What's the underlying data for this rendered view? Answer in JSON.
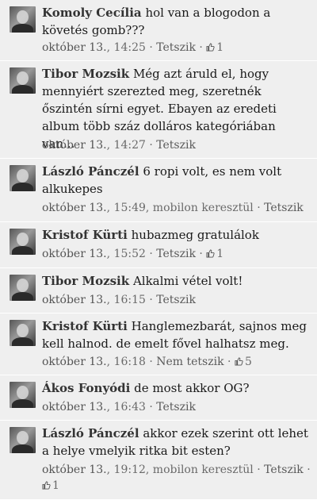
{
  "comments": [
    {
      "author": "Komoly Cecília",
      "text": "hol van a blogodon a követés gomb???",
      "date": "október 13.",
      "time": "14:25",
      "like_label": "Tetszik",
      "likes": "1"
    },
    {
      "author": "Tibor Mozsik",
      "text": "Még azt áruld el, hogy mennyiért szerezted meg, szeretnék őszintén sírni egyet. Ebayen az eredeti album több száz dolláros kategóriában van...",
      "date": "október 13.",
      "time": "14:27",
      "like_label": "Tetszik"
    },
    {
      "author": "László Pánczél",
      "text": "6 ropi volt, es nem volt alkukepes",
      "date": "október 13.",
      "time": "15:49",
      "via": "mobilon keresztül",
      "like_label": "Tetszik"
    },
    {
      "author": "Kristof Kürti",
      "text": "hubazmeg gratulálok",
      "date": "október 13.",
      "time": "15:52",
      "like_label": "Tetszik",
      "likes": "1"
    },
    {
      "author": "Tibor Mozsik",
      "text": "Alkalmi vétel volt!",
      "date": "október 13.",
      "time": "16:15",
      "like_label": "Tetszik"
    },
    {
      "author": "Kristof Kürti",
      "text": "Hanglemezbarát, sajnos meg kell halnod. de emelt fővel halhatsz meg.",
      "date": "október 13.",
      "time": "16:18",
      "like_label": "Nem tetszik",
      "likes": "5"
    },
    {
      "author": "Ákos Fonyódi",
      "text": "de most akkor OG?",
      "date": "október 13.",
      "time": "16:43",
      "like_label": "Tetszik"
    },
    {
      "author": "László Pánczél",
      "text": "akkor ezek szerint ott lehet a helye vmelyik ritka bit esten?",
      "date": "október 13.",
      "time": "19:12",
      "via": "mobilon keresztül",
      "like_label": "Tetszik",
      "likes": "1"
    }
  ],
  "separator": "·",
  "icons": {
    "like": "thumbs-up-icon"
  }
}
